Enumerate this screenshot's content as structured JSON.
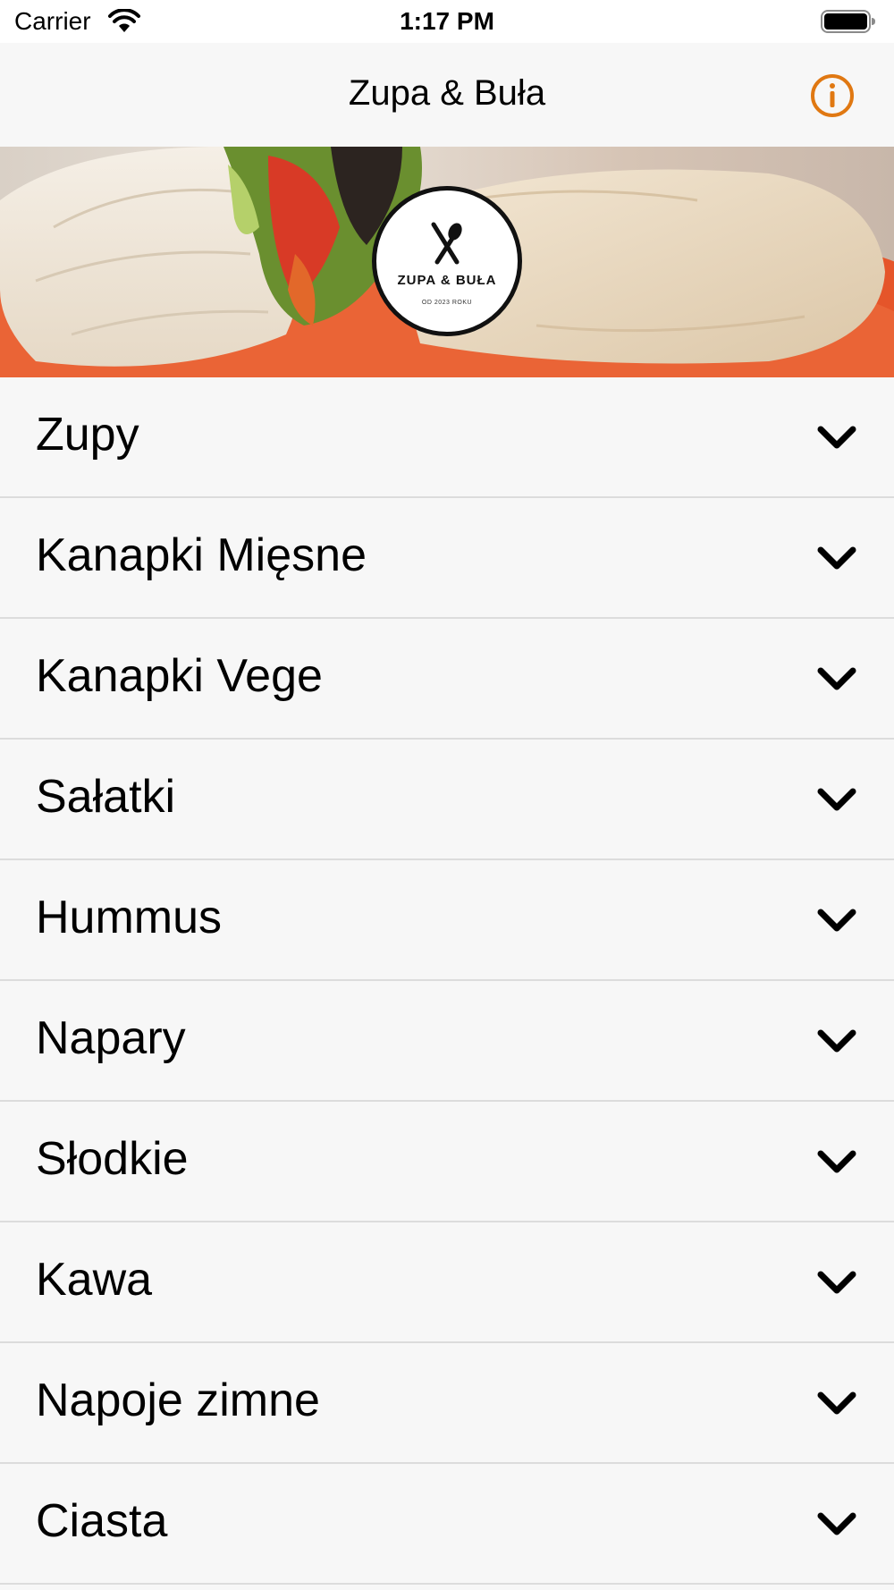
{
  "status_bar": {
    "carrier": "Carrier",
    "time": "1:17 PM",
    "icons": [
      "wifi-icon",
      "battery-icon"
    ]
  },
  "nav": {
    "title": "Zupa & Buła",
    "info_icon": "info-icon",
    "accent_color": "#E07812"
  },
  "banner": {
    "logo_name": "ZUPA & BUŁA",
    "logo_subtitle": "OD 2023 ROKU"
  },
  "menu": {
    "items": [
      {
        "label": "Zupy"
      },
      {
        "label": "Kanapki Mięsne"
      },
      {
        "label": "Kanapki Vege"
      },
      {
        "label": "Sałatki"
      },
      {
        "label": "Hummus"
      },
      {
        "label": "Napary"
      },
      {
        "label": "Słodkie"
      },
      {
        "label": "Kawa"
      },
      {
        "label": "Napoje zimne"
      },
      {
        "label": "Ciasta"
      }
    ],
    "expand_icon": "chevron-down-icon"
  }
}
